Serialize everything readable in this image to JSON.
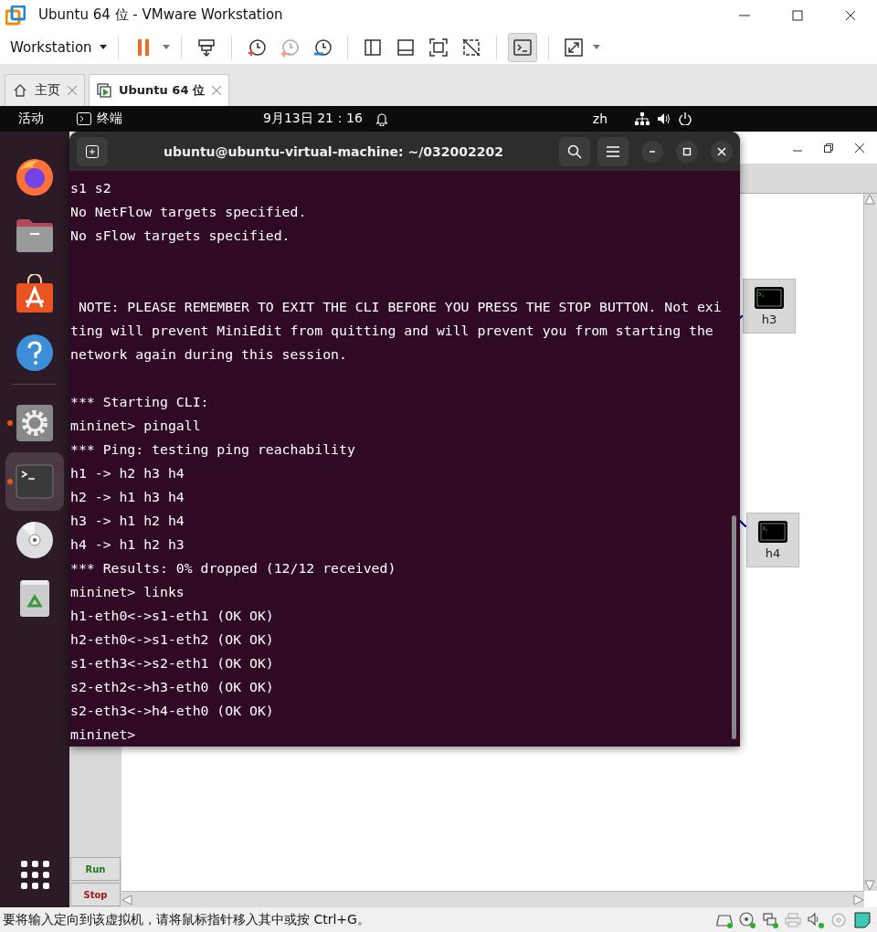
{
  "window": {
    "title": "Ubuntu 64 位 - VMware Workstation"
  },
  "toolbar": {
    "menu": "Workstation",
    "console_view": {
      "selected": true
    }
  },
  "tabs": [
    {
      "label": "主页",
      "selected": false
    },
    {
      "label": "Ubuntu 64 位",
      "selected": true
    }
  ],
  "guest": {
    "top_bar": {
      "activities": "活动",
      "app": "终端",
      "clock": "9月13日  21：16",
      "input_method": "zh"
    },
    "dock": [
      {
        "kind": "browser",
        "running": false,
        "selected": false
      },
      {
        "kind": "files",
        "running": false,
        "selected": false
      },
      {
        "kind": "store",
        "running": false,
        "selected": false
      },
      {
        "kind": "help",
        "running": false,
        "selected": false
      },
      {
        "kind": "settings",
        "running": true,
        "selected": false
      },
      {
        "kind": "terminal",
        "running": true,
        "selected": true
      },
      {
        "kind": "disc",
        "running": false,
        "selected": false
      },
      {
        "kind": "trash",
        "running": false,
        "selected": false
      }
    ],
    "terminal": {
      "title": "ubuntu@ubuntu-virtual-machine: ~/032002202",
      "lines": [
        {
          "kind": "text",
          "text": "s1 s2"
        },
        {
          "kind": "text",
          "text": "No NetFlow targets specified."
        },
        {
          "kind": "text",
          "text": "No sFlow targets specified."
        },
        {
          "kind": "blank"
        },
        {
          "kind": "blank"
        },
        {
          "kind": "text",
          "text": " NOTE: PLEASE REMEMBER TO EXIT THE CLI BEFORE YOU PRESS THE STOP BUTTON. Not exi"
        },
        {
          "kind": "text",
          "text": "ting will prevent MiniEdit from quitting and will prevent you from starting the"
        },
        {
          "kind": "text",
          "text": "network again during this session."
        },
        {
          "kind": "blank"
        },
        {
          "kind": "text",
          "text": "*** Starting CLI:"
        },
        {
          "kind": "text",
          "text": "mininet> pingall"
        },
        {
          "kind": "text",
          "text": "*** Ping: testing ping reachability"
        },
        {
          "kind": "text",
          "text": "h1 -> h2 h3 h4"
        },
        {
          "kind": "text",
          "text": "h2 -> h1 h3 h4"
        },
        {
          "kind": "text",
          "text": "h3 -> h1 h2 h4"
        },
        {
          "kind": "text",
          "text": "h4 -> h1 h2 h3"
        },
        {
          "kind": "text",
          "text": "*** Results: 0% dropped (12/12 received)"
        },
        {
          "kind": "text",
          "text": "mininet> links"
        },
        {
          "kind": "text",
          "text": "h1-eth0<->s1-eth1 (OK OK)"
        },
        {
          "kind": "text",
          "text": "h2-eth0<->s1-eth2 (OK OK)"
        },
        {
          "kind": "text",
          "text": "s1-eth3<->s2-eth1 (OK OK)"
        },
        {
          "kind": "text",
          "text": "s2-eth2<->h3-eth0 (OK OK)"
        },
        {
          "kind": "text",
          "text": "s2-eth3<->h4-eth0 (OK OK)"
        },
        {
          "kind": "text",
          "text": "mininet>"
        }
      ]
    },
    "miniedit": {
      "nodes": [
        {
          "label": "h3"
        },
        {
          "label": "h4"
        }
      ],
      "buttons": [
        {
          "kind": "run",
          "label": "Run"
        },
        {
          "kind": "stop",
          "label": "Stop"
        }
      ]
    }
  },
  "status_bar": {
    "message": "要将输入定向到该虚拟机，请将鼠标指针移入其中或按 Ctrl+G。"
  }
}
